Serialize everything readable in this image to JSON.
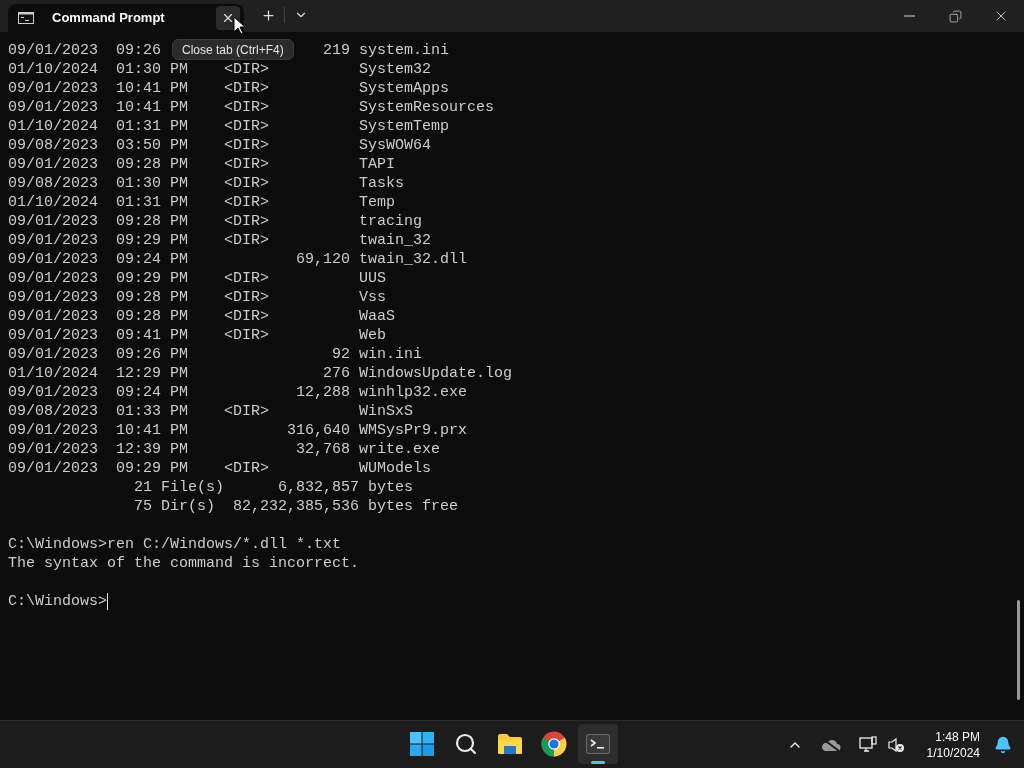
{
  "window": {
    "tab": {
      "title": "Command Prompt",
      "selected": true
    },
    "tooltip": "Close tab (Ctrl+F4)"
  },
  "terminal": {
    "lines": [
      {
        "kind": "partial",
        "text": "09/01/2023  09:26",
        "tail": "219 system.ini"
      },
      {
        "kind": "text",
        "text": "01/10/2024  01:30 PM    <DIR>          System32"
      },
      {
        "kind": "text",
        "text": "09/01/2023  10:41 PM    <DIR>          SystemApps"
      },
      {
        "kind": "text",
        "text": "09/01/2023  10:41 PM    <DIR>          SystemResources"
      },
      {
        "kind": "text",
        "text": "01/10/2024  01:31 PM    <DIR>          SystemTemp"
      },
      {
        "kind": "text",
        "text": "09/08/2023  03:50 PM    <DIR>          SysWOW64"
      },
      {
        "kind": "text",
        "text": "09/01/2023  09:28 PM    <DIR>          TAPI"
      },
      {
        "kind": "text",
        "text": "09/08/2023  01:30 PM    <DIR>          Tasks"
      },
      {
        "kind": "text",
        "text": "01/10/2024  01:31 PM    <DIR>          Temp"
      },
      {
        "kind": "text",
        "text": "09/01/2023  09:28 PM    <DIR>          tracing"
      },
      {
        "kind": "text",
        "text": "09/01/2023  09:29 PM    <DIR>          twain_32"
      },
      {
        "kind": "text",
        "text": "09/01/2023  09:24 PM            69,120 twain_32.dll"
      },
      {
        "kind": "text",
        "text": "09/01/2023  09:29 PM    <DIR>          UUS"
      },
      {
        "kind": "text",
        "text": "09/01/2023  09:28 PM    <DIR>          Vss"
      },
      {
        "kind": "text",
        "text": "09/01/2023  09:28 PM    <DIR>          WaaS"
      },
      {
        "kind": "text",
        "text": "09/01/2023  09:41 PM    <DIR>          Web"
      },
      {
        "kind": "text",
        "text": "09/01/2023  09:26 PM                92 win.ini"
      },
      {
        "kind": "text",
        "text": "01/10/2024  12:29 PM               276 WindowsUpdate.log"
      },
      {
        "kind": "text",
        "text": "09/01/2023  09:24 PM            12,288 winhlp32.exe"
      },
      {
        "kind": "text",
        "text": "09/08/2023  01:33 PM    <DIR>          WinSxS"
      },
      {
        "kind": "text",
        "text": "09/01/2023  10:41 PM           316,640 WMSysPr9.prx"
      },
      {
        "kind": "text",
        "text": "09/01/2023  12:39 PM            32,768 write.exe"
      },
      {
        "kind": "text",
        "text": "09/01/2023  09:29 PM    <DIR>          WUModels"
      },
      {
        "kind": "text",
        "text": "              21 File(s)      6,832,857 bytes"
      },
      {
        "kind": "text",
        "text": "              75 Dir(s)  82,232,385,536 bytes free"
      },
      {
        "kind": "blank"
      },
      {
        "kind": "text",
        "text": "C:\\Windows>ren C:/Windows/*.dll *.txt"
      },
      {
        "kind": "text",
        "text": "The syntax of the command is incorrect."
      },
      {
        "kind": "blank"
      },
      {
        "kind": "prompt",
        "text": "C:\\Windows>"
      }
    ]
  },
  "taskbar": {
    "apps": [
      {
        "kind": "start",
        "active": false
      },
      {
        "kind": "search",
        "active": false
      },
      {
        "kind": "explorer",
        "active": false
      },
      {
        "kind": "chrome",
        "active": false
      },
      {
        "kind": "terminal",
        "active": true
      }
    ],
    "clock": {
      "time": "1:48 PM",
      "date": "1/10/2024"
    }
  }
}
